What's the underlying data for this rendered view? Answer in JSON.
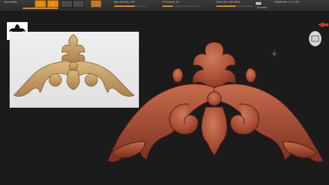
{
  "toolbar": {
    "project_label": "Draw Solid",
    "buttons": [
      "Edit",
      "Draw",
      "Move",
      "Scale",
      "Rotate"
    ],
    "rgb_intensity": "Rgb Intensity 100",
    "z_intensity": "Z Intensity 30",
    "draw_size": "Draw Size 108.0826",
    "dynamic": "Dynamic",
    "total_points": "TotalPoints: 1.114 Mil"
  },
  "colors": {
    "accent": "#e88a10",
    "background": "#1b1b1b",
    "model": "#b0553a"
  }
}
